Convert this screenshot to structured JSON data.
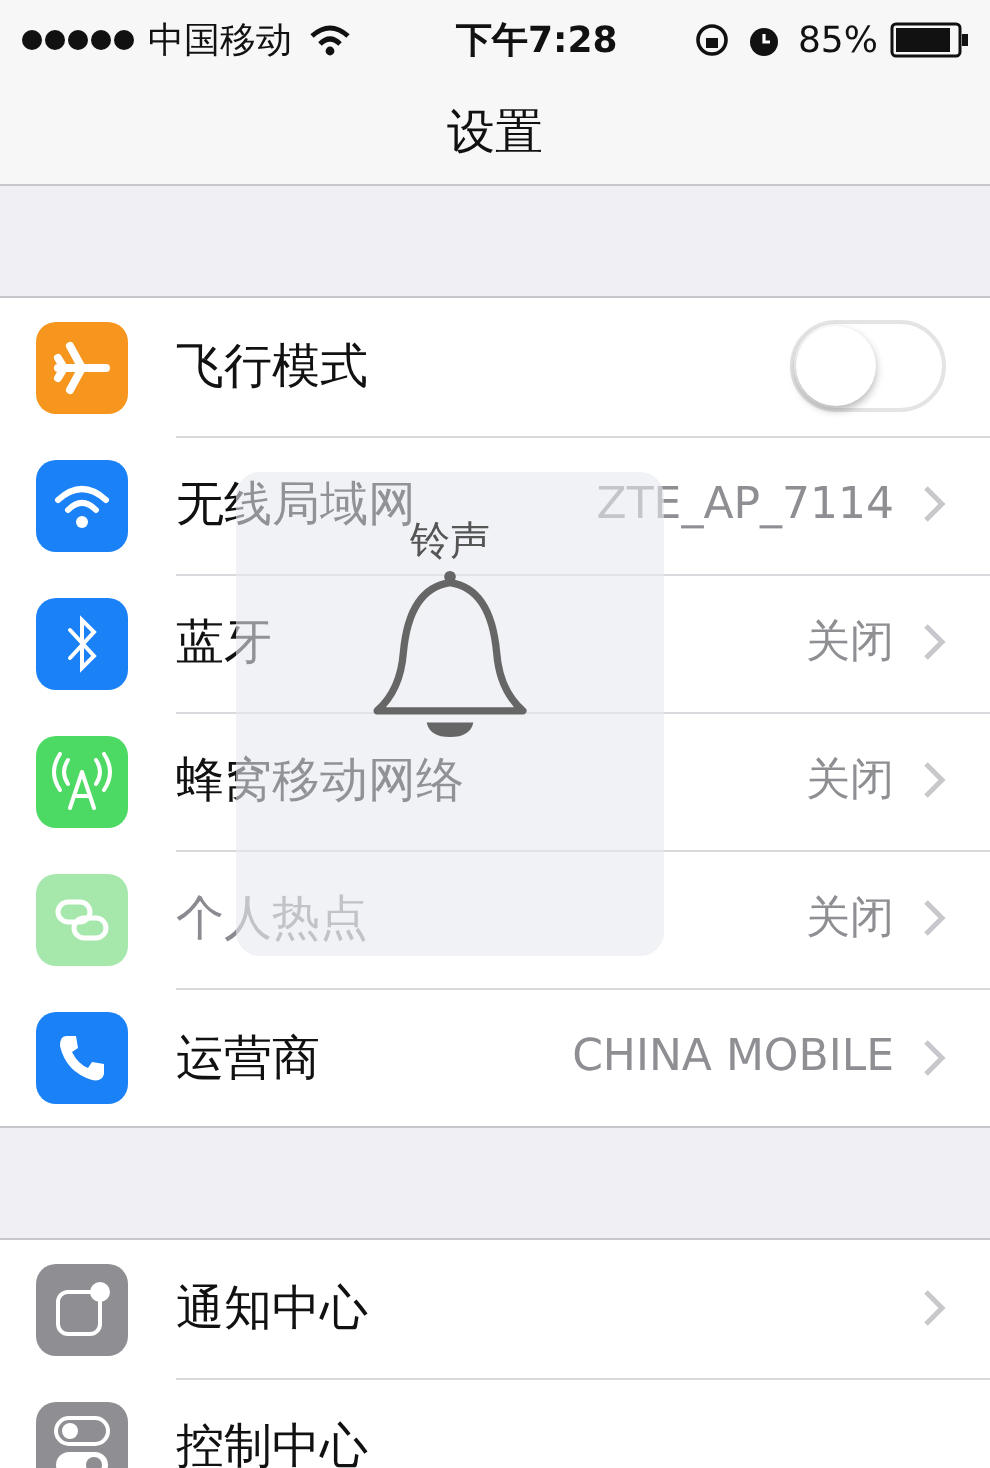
{
  "status_bar": {
    "carrier": "中国移动",
    "time": "下午7:28",
    "battery": "85%"
  },
  "nav_bar": {
    "title": "设置"
  },
  "sections": [
    {
      "rows": [
        {
          "kind": "toggle",
          "color": "#f7961e",
          "label": "飞行模式",
          "on": false,
          "disabled": false
        },
        {
          "kind": "link",
          "color": "#1a82f6",
          "label": "无线局域网",
          "value": "ZTE_AP_7114",
          "disabled": false
        },
        {
          "kind": "link",
          "color": "#1a82f6",
          "label": "蓝牙",
          "value": "关闭",
          "disabled": false
        },
        {
          "kind": "link",
          "color": "#4cd964",
          "label": "蜂窝移动网络",
          "value": "关闭",
          "disabled": false
        },
        {
          "kind": "link",
          "color": "#a6e8ac",
          "label": "个人热点",
          "value": "关闭",
          "disabled": true
        },
        {
          "kind": "link",
          "color": "#1a82f6",
          "label": "运营商",
          "value": "CHINA MOBILE",
          "disabled": false
        }
      ]
    },
    {
      "rows": [
        {
          "kind": "link",
          "color": "#8e8e93",
          "label": "通知中心",
          "disabled": false
        },
        {
          "kind": "plain",
          "color": "#8e8e93",
          "label": "控制中心",
          "disabled": false
        }
      ]
    }
  ],
  "ringer_overlay": {
    "title": "铃声"
  }
}
